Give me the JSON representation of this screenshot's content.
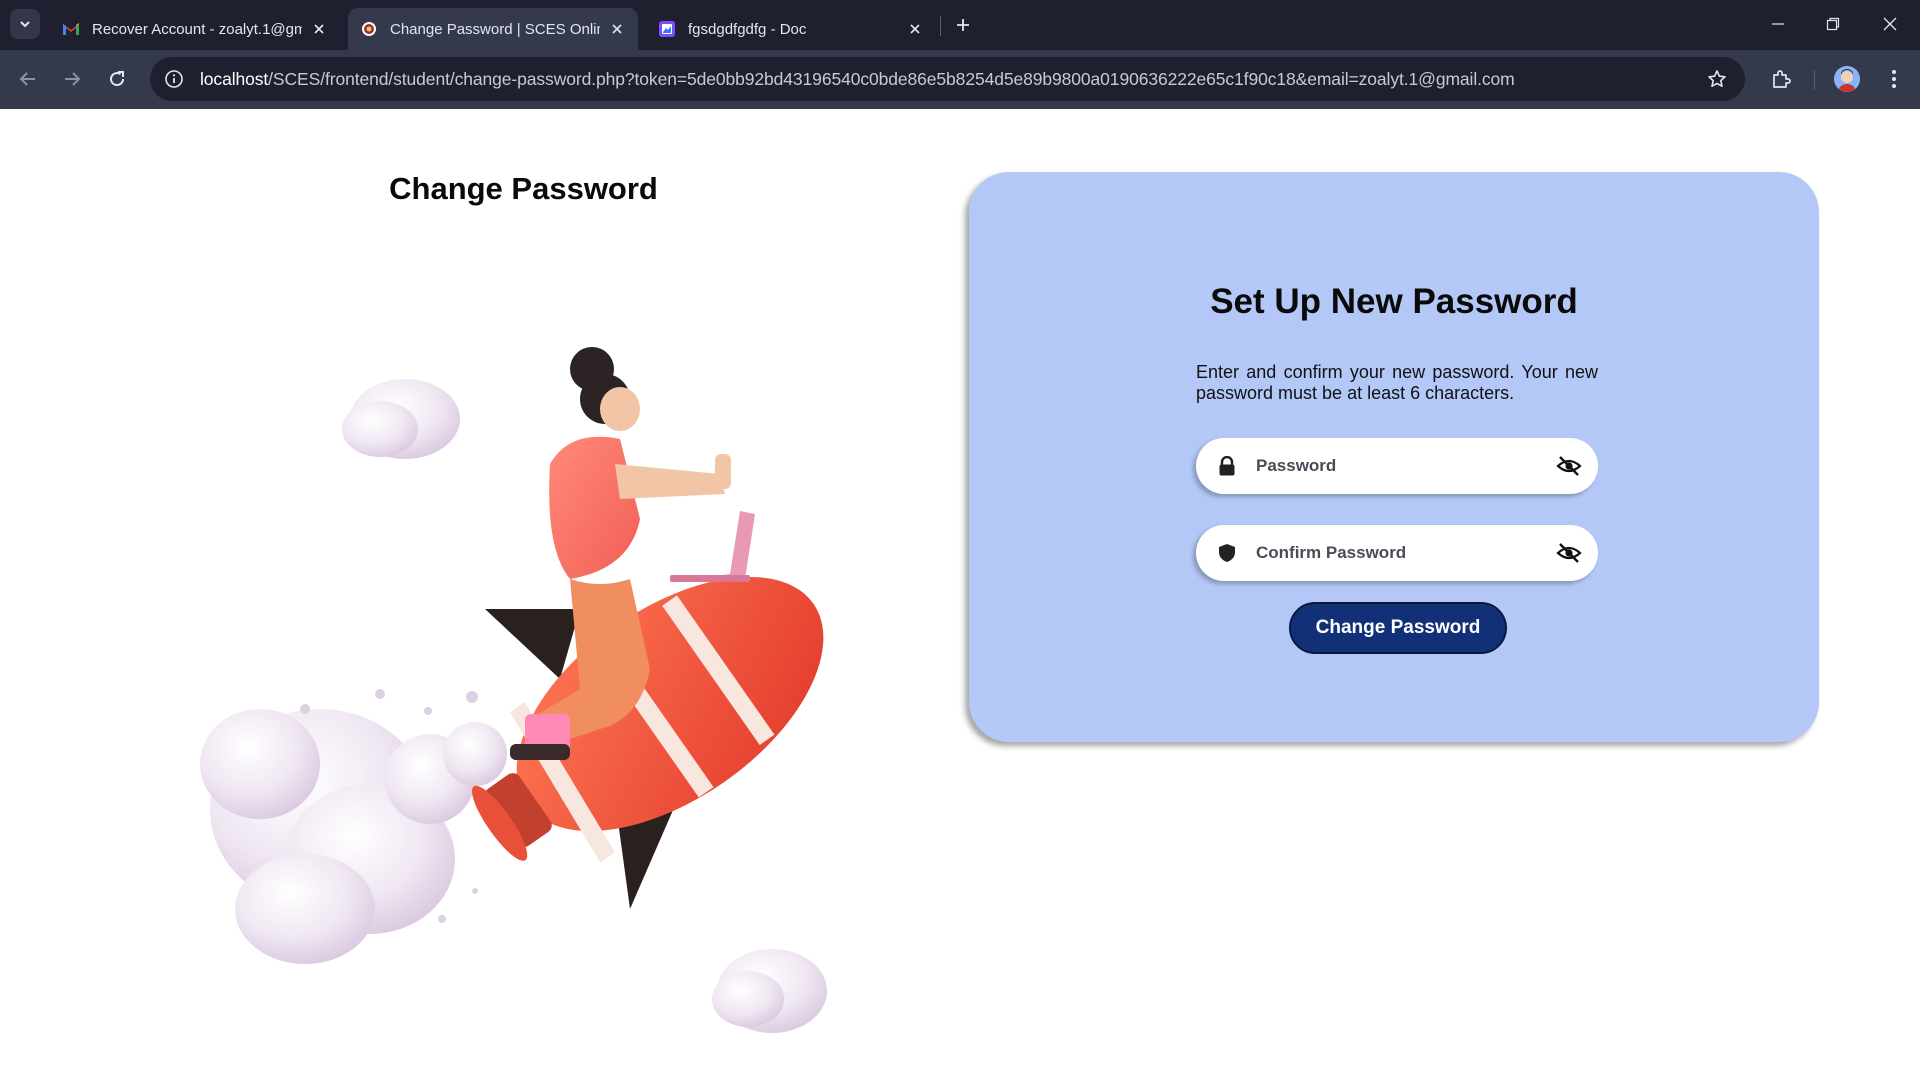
{
  "browser": {
    "tabs": [
      {
        "title": "Recover Account - zoalyt.1@gm",
        "favicon": "gmail-icon",
        "active": false
      },
      {
        "title": "Change Password | SCES Online",
        "favicon": "sces-logo-icon",
        "active": true
      },
      {
        "title": "fgsdgdfgdfg - Doc",
        "favicon": "doc-icon",
        "active": false
      }
    ],
    "url_host": "localhost",
    "url_rest": "/SCES/frontend/student/change-password.php?token=5de0bb92bd43196540c0bde86e5b8254d5e89b9800a0190636222e65c1f90c18&email=zoalyt.1@gmail.com"
  },
  "page": {
    "left_title": "Change Password",
    "illustration": "woman-riding-rocket-with-laptop-illustration",
    "card": {
      "title": "Set Up New Password",
      "description": "Enter and confirm your new password. Your new password must be at least 6 characters.",
      "password_placeholder": "Password",
      "confirm_placeholder": "Confirm Password",
      "submit_label": "Change Password",
      "colors": {
        "card_bg": "#b3c8f7",
        "button_bg": "#123078"
      }
    }
  }
}
